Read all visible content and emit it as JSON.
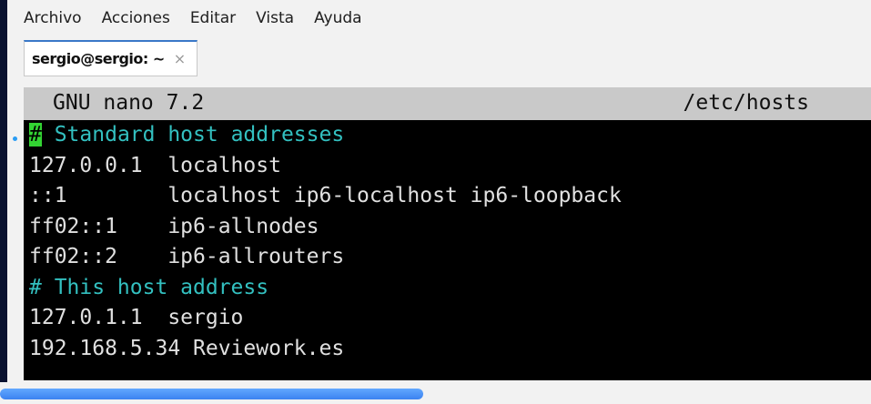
{
  "menu": {
    "items": [
      "Archivo",
      "Acciones",
      "Editar",
      "Vista",
      "Ayuda"
    ]
  },
  "tabs": [
    {
      "label": "sergio@sergio: ~",
      "close": "×"
    }
  ],
  "nano": {
    "version": "GNU nano 7.2",
    "filename": "/etc/hosts"
  },
  "file_lines": [
    {
      "text": " Standard host addresses",
      "type": "comment",
      "prefix": "#"
    },
    {
      "text": "127.0.0.1  localhost",
      "type": "plain"
    },
    {
      "text": "::1        localhost ip6-localhost ip6-loopback",
      "type": "plain"
    },
    {
      "text": "ff02::1    ip6-allnodes",
      "type": "plain"
    },
    {
      "text": "ff02::2    ip6-allrouters",
      "type": "plain"
    },
    {
      "text": "# This host address",
      "type": "comment"
    },
    {
      "text": "127.0.1.1  sergio",
      "type": "plain"
    },
    {
      "text": "192.168.5.34 Reviework.es",
      "type": "plain"
    }
  ],
  "colors": {
    "terminal_bg": "#000000",
    "terminal_fg": "#e0e0e0",
    "comment": "#33c0c0",
    "cursor": "#33d433",
    "titlebar_bg": "#c9c9c9",
    "accent": "#3a78c8"
  }
}
